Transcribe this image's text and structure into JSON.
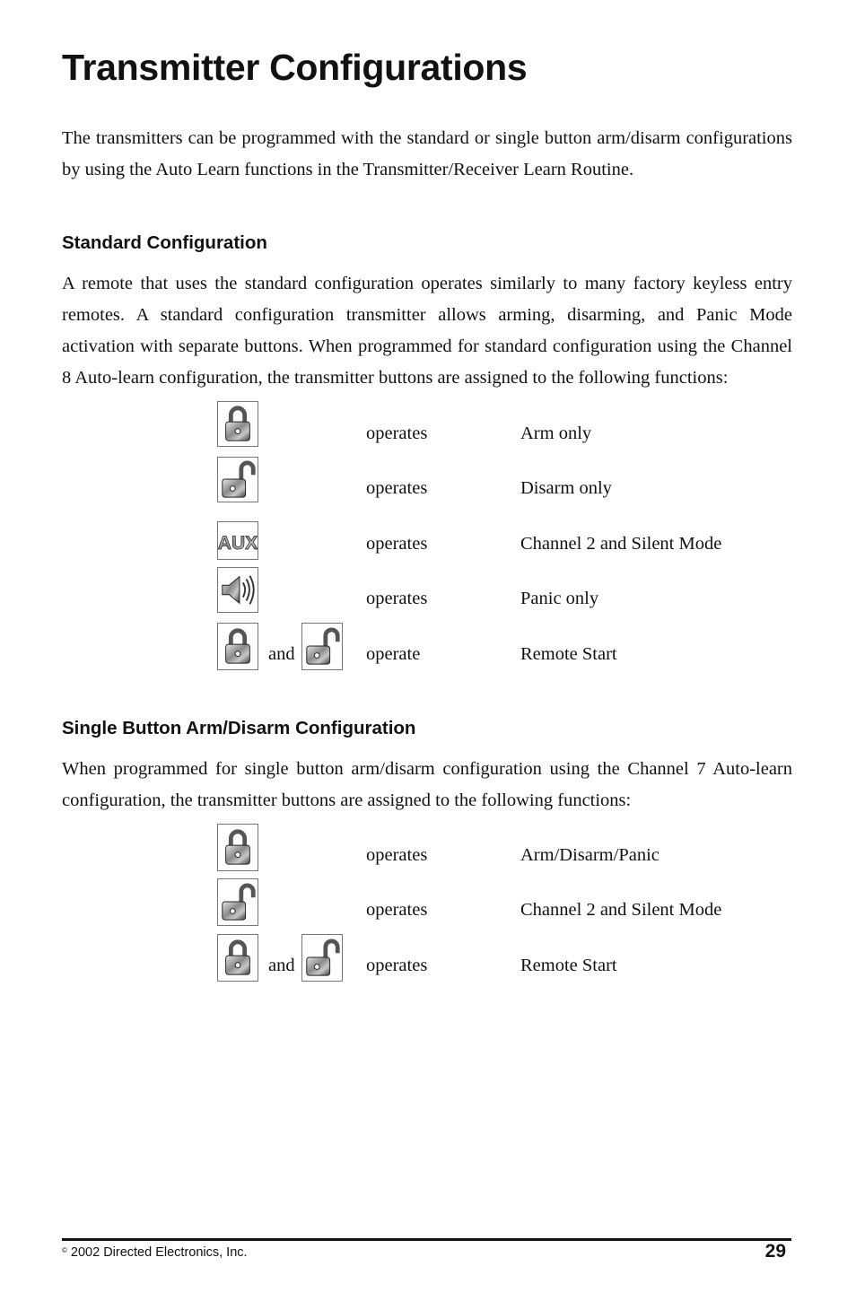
{
  "title": "Transmitter Configurations",
  "intro": "The transmitters can be programmed with the standard or single button arm/disarm configurations by using the Auto Learn functions in the Transmitter/Receiver Learn Routine.",
  "standard": {
    "heading": "Standard Configuration",
    "paragraph": "A remote that uses the standard configuration operates similarly to many factory keyless entry remotes. A standard configuration transmitter allows arming, disarming, and Panic Mode activation with separate buttons. When programmed for standard configuration using the Channel 8 Auto-learn configuration, the transmitter buttons are assigned to the following functions:",
    "rows": [
      {
        "icons": [
          "lock-closed"
        ],
        "verb": "operates",
        "function": "Arm only"
      },
      {
        "icons": [
          "lock-open"
        ],
        "verb": "operates",
        "function": "Disarm only"
      },
      {
        "icons": [
          "aux"
        ],
        "verb": "operates",
        "function": "Channel 2 and Silent Mode"
      },
      {
        "icons": [
          "speaker"
        ],
        "verb": "operates",
        "function": "Panic only"
      },
      {
        "icons": [
          "lock-closed",
          "lock-open"
        ],
        "joiner": "and",
        "verb": "operate",
        "function": "Remote Start"
      }
    ]
  },
  "single": {
    "heading": "Single Button Arm/Disarm Configuration",
    "paragraph": "When programmed for single button arm/disarm configuration using the Channel 7 Auto-learn configuration, the transmitter buttons are assigned to the following functions:",
    "rows": [
      {
        "icons": [
          "lock-closed"
        ],
        "verb": "operates",
        "function": "Arm/Disarm/Panic"
      },
      {
        "icons": [
          "lock-open"
        ],
        "verb": "operates",
        "function": "Channel 2 and Silent Mode"
      },
      {
        "icons": [
          "lock-closed",
          "lock-open"
        ],
        "joiner": "and",
        "verb": "operates",
        "function": "Remote Start"
      }
    ]
  },
  "footer": {
    "copyright_symbol": "©",
    "copyright": "2002 Directed Electronics, Inc.",
    "page_number": "29"
  }
}
